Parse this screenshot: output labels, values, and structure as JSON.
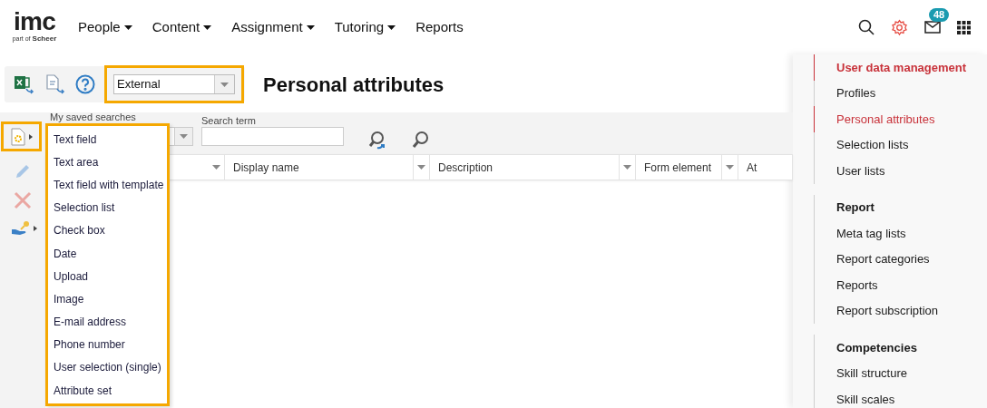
{
  "logo": {
    "name": "imc",
    "tagline_prefix": "part of",
    "tagline": "Scheer"
  },
  "nav": [
    {
      "label": "People",
      "dropdown": true
    },
    {
      "label": "Content",
      "dropdown": true
    },
    {
      "label": "Assignment",
      "dropdown": true
    },
    {
      "label": "Tutoring",
      "dropdown": true
    },
    {
      "label": "Reports",
      "dropdown": false
    }
  ],
  "header_icons": {
    "settings_active": true,
    "mail_badge": "48"
  },
  "toolbar": {
    "scope": {
      "value": "External",
      "highlighted": true
    }
  },
  "page_title": "Personal attributes",
  "search": {
    "saved_label": "My saved searches",
    "term_label": "Search term"
  },
  "side_tools": {
    "new_highlighted": true,
    "edit_disabled": true,
    "delete_disabled": true
  },
  "new_menu": {
    "highlighted": true,
    "items": [
      "Text field",
      "Text area",
      "Text field with template",
      "Selection list",
      "Check box",
      "Date",
      "Upload",
      "Image",
      "E-mail address",
      "Phone number",
      "User selection (single)",
      "Attribute set"
    ]
  },
  "table": {
    "columns": [
      "Display name",
      "Description",
      "Form element",
      "At"
    ]
  },
  "side_menu": [
    {
      "items": [
        {
          "label": "User data management",
          "kind": "heading",
          "selected": true
        },
        {
          "label": "Profiles",
          "kind": "link",
          "selected": false
        },
        {
          "label": "Personal attributes",
          "kind": "link",
          "selected": true
        },
        {
          "label": "Selection lists",
          "kind": "link",
          "selected": false
        },
        {
          "label": "User lists",
          "kind": "link",
          "selected": false
        }
      ]
    },
    {
      "items": [
        {
          "label": "Report",
          "kind": "heading",
          "selected": false
        },
        {
          "label": "Meta tag lists",
          "kind": "link",
          "selected": false
        },
        {
          "label": "Report categories",
          "kind": "link",
          "selected": false
        },
        {
          "label": "Reports",
          "kind": "link",
          "selected": false
        },
        {
          "label": "Report subscription",
          "kind": "link",
          "selected": false
        }
      ]
    },
    {
      "items": [
        {
          "label": "Competencies",
          "kind": "heading",
          "selected": false
        },
        {
          "label": "Skill structure",
          "kind": "link",
          "selected": false
        },
        {
          "label": "Skill scales",
          "kind": "link",
          "selected": false
        }
      ]
    }
  ]
}
